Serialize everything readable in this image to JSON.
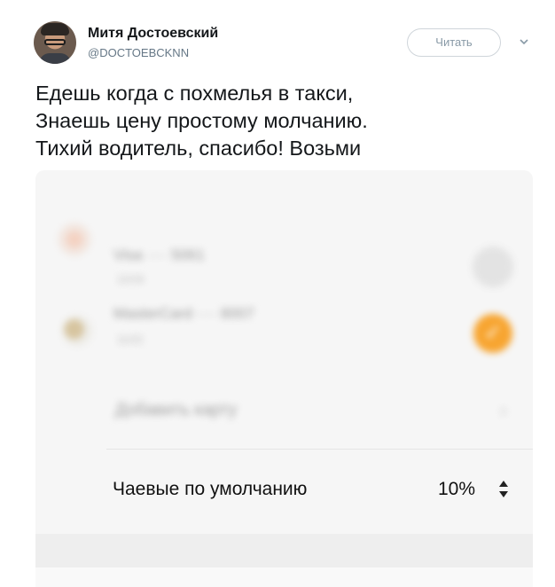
{
  "tweet": {
    "author_name": "Митя Достоевский",
    "author_handle": "@DOCTOEBCKNN",
    "follow_label": "Читать",
    "caret_icon": "chevron-down-icon",
    "text_lines": [
      "Едешь когда с похмелья в такси,",
      "Знаешь цену простому молчанию.",
      "Тихий водитель, спасибо! Возьми"
    ]
  },
  "screenshot": {
    "cards": [
      {
        "title": "Visa ···· 5061",
        "subtitle": "12/19",
        "selected": false,
        "icon": "visa-icon"
      },
      {
        "title": "MasterCard ···· 8007",
        "subtitle": "11/22",
        "selected": true,
        "icon": "mastercard-icon"
      }
    ],
    "add_card_label": "Добавить карту",
    "tip_label": "Чаевые по умолчанию",
    "tip_value": "10%",
    "check_glyph": "✓",
    "chevron_glyph": "›",
    "colors": {
      "accent": "#f7a531",
      "background": "#f6f6f6"
    }
  }
}
